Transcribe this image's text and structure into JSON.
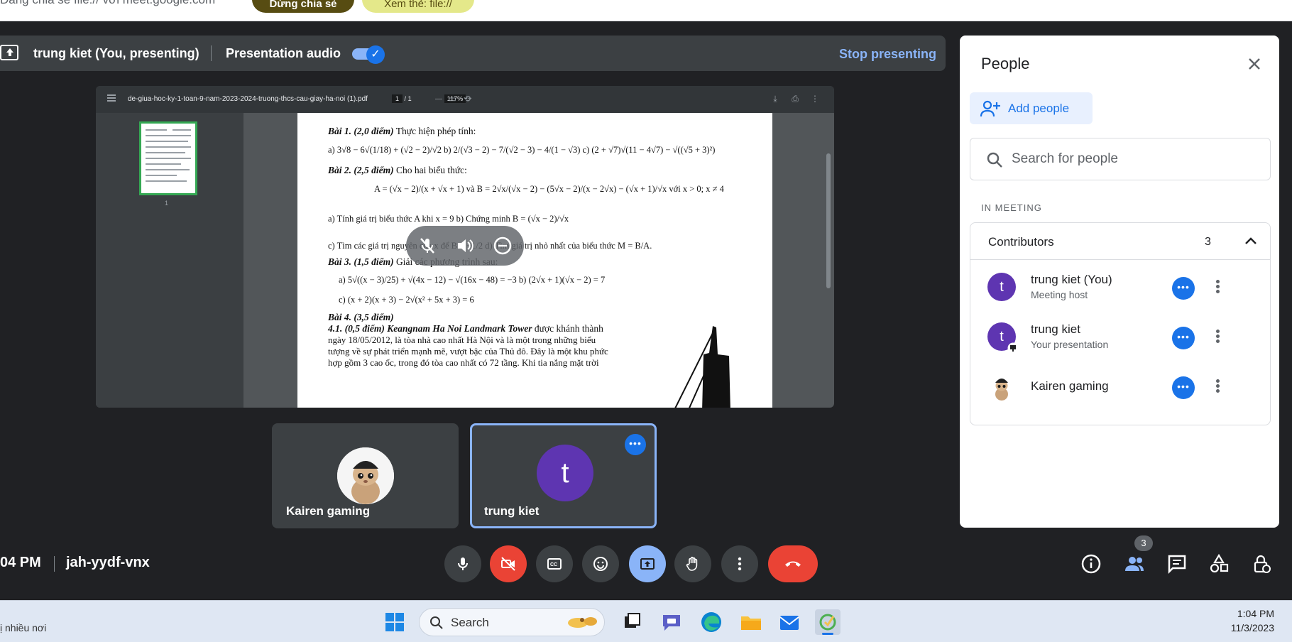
{
  "notification": {
    "message": "Đang chia sẻ file:// với meet.google.com",
    "share_button": "Dừng chia sẻ",
    "view_button": "Xem thẻ: file://"
  },
  "presenting_bar": {
    "presenter": "trung kiet (You, presenting)",
    "audio_label": "Presentation audio",
    "audio_enabled": true,
    "stop_button": "Stop presenting"
  },
  "pdf_viewer": {
    "filename": "de-giua-hoc-ky-1-toan-9-nam-2023-2024-truong-thcs-cau-giay-ha-noi (1).pdf",
    "current_page": "1",
    "page_sep": "/",
    "total_pages": "1",
    "zoom_out": "—",
    "zoom_level": "117%",
    "zoom_in": "+",
    "thumbnail_number": "1",
    "page_lines": [
      {
        "bold": "Bài 1. (2,0 điểm)",
        "text": " Thực hiện phép tính:"
      },
      {
        "bold": "",
        "text": "a) 3√8 − 6√(1/18) + (√2 − 2)/√2       b) 2/(√3 − 2) − 7/(√2 − 3) − 4/(1 − √3)       c) (2 + √7)√(11 − 4√7) − √((√5 + 3)²)"
      },
      {
        "bold": "Bài 2. (2,5 điểm)",
        "text": " Cho hai biểu thức:"
      },
      {
        "bold": "",
        "text": "A = (√x − 2)/(x + √x + 1) và B = 2√x/(√x − 2) − (5√x − 2)/(x − 2√x) − (√x + 1)/√x   với x > 0; x ≠ 4"
      },
      {
        "bold": "",
        "text": "a) Tính giá trị biểu thức A khi x = 9              b) Chứng minh B = (√x − 2)/√x"
      },
      {
        "bold": "",
        "text": "c) Tìm các giá trị nguyên của x để B ≤ −1/2         d) Tìm giá trị nhỏ nhất của biểu thức M = B/A."
      },
      {
        "bold": "Bài 3. (1,5 điểm)",
        "text": " Giải các phương trình sau:"
      },
      {
        "bold": "",
        "text": "a) 5√((x − 3)/25) + √(4x − 12) − √(16x − 48) = −3          b) (2√x + 1)(√x − 2) = 7"
      },
      {
        "bold": "",
        "text": "c) (x + 2)(x + 3) − 2√(x² + 5x + 3) = 6"
      },
      {
        "bold": "Bài 4. (3,5 điểm)",
        "text": ""
      },
      {
        "bold": "4.1. (0,5 điểm) Keangnam Ha Noi Landmark Tower",
        "text": " được khánh thành"
      },
      {
        "bold": "",
        "text": "ngày 18/05/2012, là tòa nhà cao nhất Hà Nội và là một trong những biểu"
      },
      {
        "bold": "",
        "text": "tượng về sự phát triển mạnh mẽ, vượt bậc của Thủ đô. Đây là một khu phức"
      },
      {
        "bold": "",
        "text": "hợp gồm 3 cao ốc, trong đó tòa cao nhất có 72 tầng. Khi tia nắng mặt trời"
      }
    ]
  },
  "tiles": [
    {
      "name": "Kairen gaming",
      "avatar": "cat-avatar"
    },
    {
      "name": "trung kiet",
      "avatar_letter": "t",
      "active": true
    }
  ],
  "bottom_bar": {
    "time": "04 PM",
    "meeting_code": "jah-yydf-vnx",
    "participant_count": "3"
  },
  "people_panel": {
    "title": "People",
    "add_people": "Add people",
    "search_placeholder": "Search for people",
    "section_label": "IN MEETING",
    "group_label": "Contributors",
    "group_count": "3",
    "people": [
      {
        "name": "trung kiet (You)",
        "subtitle": "Meeting host",
        "letter": "t"
      },
      {
        "name": "trung kiet",
        "subtitle": "Your presentation",
        "letter": "t"
      },
      {
        "name": "Kairen gaming",
        "subtitle": "",
        "letter": ""
      }
    ]
  },
  "taskbar": {
    "left_text": "ị nhiều nơi",
    "search_label": "Search",
    "time": "1:04 PM",
    "date": "11/3/2023"
  },
  "colors": {
    "meet_bg": "#202124",
    "panel_bg": "#3c4043",
    "accent_blue": "#8ab4f8",
    "brand_blue": "#1a73e8",
    "danger_red": "#ea4335",
    "avatar_purple": "#5e35b1"
  }
}
